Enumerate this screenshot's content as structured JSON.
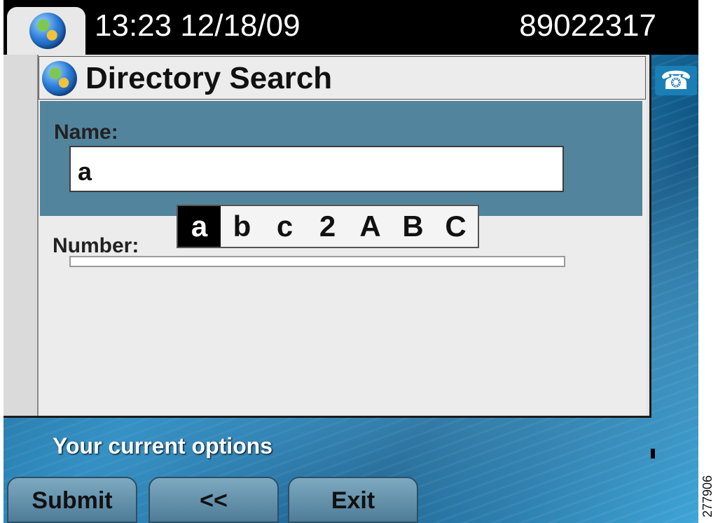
{
  "status_bar": {
    "clock": "13:23 12/18/09",
    "line_number": "89022317",
    "app_icon": "globe-icon"
  },
  "window": {
    "title": "Directory Search",
    "title_icon": "globe-icon"
  },
  "fields": {
    "name_label": "Name:",
    "name_value": "a",
    "number_label": "Number:",
    "number_value": ""
  },
  "char_picker": {
    "chars": [
      "a",
      "b",
      "c",
      "2",
      "A",
      "B",
      "C"
    ],
    "selected_index": 0
  },
  "right_icon": "phone-icon",
  "footer": {
    "options_text": "Your current options",
    "softkeys": [
      "Submit",
      "<<",
      "Exit"
    ]
  },
  "figure_id": "277906",
  "colors": {
    "name_section": "#53849e",
    "softkey": "#6f9bb5",
    "status_bar": "#000000"
  }
}
